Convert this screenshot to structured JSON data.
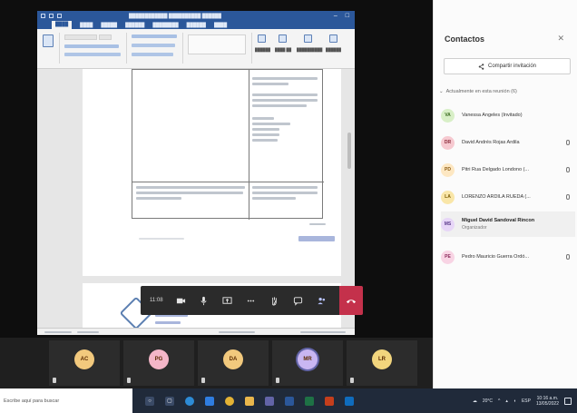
{
  "meeting": {
    "timer": "11:08",
    "controls": [
      {
        "name": "camera-button",
        "icon": "camera-icon"
      },
      {
        "name": "mic-button",
        "icon": "microphone-icon"
      },
      {
        "name": "share-screen-button",
        "icon": "share-screen-icon"
      },
      {
        "name": "more-options-button",
        "icon": "more-icon"
      },
      {
        "name": "raise-hand-button",
        "icon": "hand-icon"
      },
      {
        "name": "chat-button",
        "icon": "chat-icon"
      },
      {
        "name": "participants-button",
        "icon": "people-icon"
      }
    ],
    "hangup_icon": "hangup-icon",
    "hangup_color": "#c4314b"
  },
  "participants_strip": [
    {
      "initials": "AC",
      "color": "#f2c97d"
    },
    {
      "initials": "PG",
      "color": "#f4b6c8"
    },
    {
      "initials": "DA",
      "color": "#f2c97d"
    },
    {
      "initials": "MR",
      "color": "#c9b6f2"
    },
    {
      "initials": "LR",
      "color": "#f2d57d"
    }
  ],
  "panel": {
    "title": "Contactos",
    "share_label": "Compartir invitación",
    "section_label": "Actualmente en esta reunión (6)",
    "contacts": [
      {
        "initials": "VA",
        "name": "Vanessa Angeles (Invitado)",
        "color": "#d8efc7"
      },
      {
        "initials": "DR",
        "name": "David Andrés Rojas Ardila",
        "color": "#f6c9d0"
      },
      {
        "initials": "PD",
        "name": "Pitri Rua Delgado Londono (...",
        "color": "#fde7c2"
      },
      {
        "initials": "LA",
        "name": "LORENZO ARDILA RUEDA (...",
        "color": "#f9e6a8"
      },
      {
        "initials": "MS",
        "name": "Miguel David Sandoval Rincon",
        "role": "Organizador",
        "color": "#e7d6f7",
        "active": true
      },
      {
        "initials": "PE",
        "name": "Pedro Mauricio Guerra Ordó...",
        "color": "#f8d4e4"
      }
    ]
  },
  "taskbar": {
    "search_placeholder": "Escribe aquí para buscar",
    "apps": [
      {
        "icon": "windows-icon",
        "color": "#3a4a66"
      },
      {
        "icon": "search-icon",
        "color": "#3a4a66"
      },
      {
        "icon": "task-view-icon",
        "color": "#2d8bd6"
      },
      {
        "icon": "edge-icon",
        "color": "#2f7de1"
      },
      {
        "icon": "chrome-icon",
        "color": "#e2b235"
      },
      {
        "icon": "file-explorer-icon",
        "color": "#e8b64c"
      },
      {
        "icon": "teams-icon",
        "color": "#6264a7"
      },
      {
        "icon": "word-icon",
        "color": "#2b579a"
      },
      {
        "icon": "excel-icon",
        "color": "#1e7145"
      },
      {
        "icon": "powerpoint-icon",
        "color": "#c43e1c"
      },
      {
        "icon": "outlook-icon",
        "color": "#e8b64c"
      }
    ],
    "temperature": "20°C",
    "language": "ESP",
    "time": "10:16 a.m.",
    "date": "13/05/2022"
  }
}
